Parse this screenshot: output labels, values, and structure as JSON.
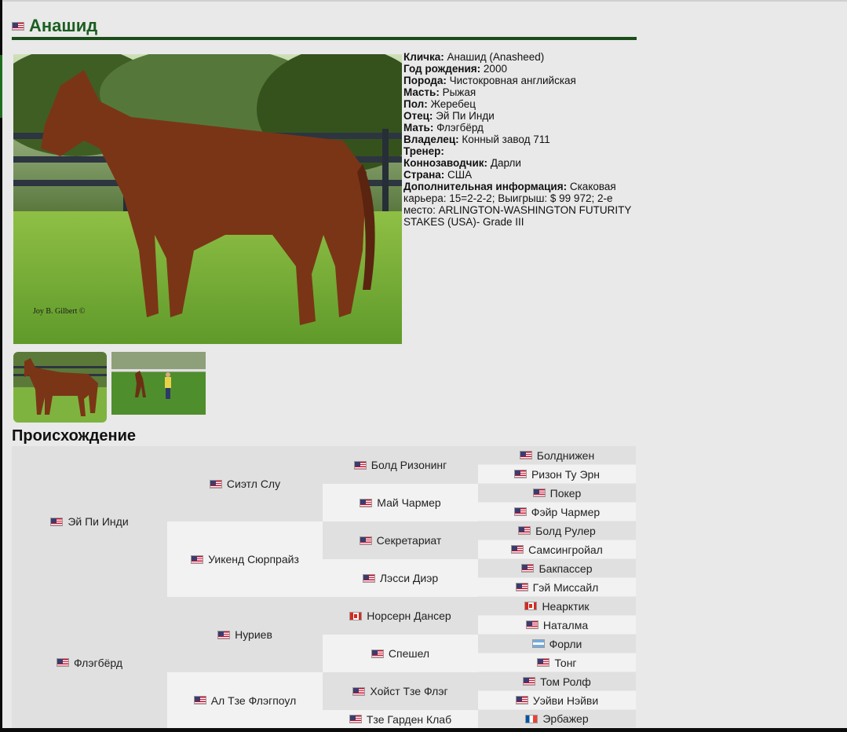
{
  "horse": {
    "title": "Анашид",
    "title_flag": "us-flag-icon"
  },
  "info": [
    {
      "label": "Кличка:",
      "value": " Анашид (Anasheed)"
    },
    {
      "label": "Год рождения:",
      "value": " 2000"
    },
    {
      "label": "Порода:",
      "value": " Чистокровная английская"
    },
    {
      "label": "Масть:",
      "value": " Рыжая"
    },
    {
      "label": "Пол:",
      "value": " Жеребец"
    },
    {
      "label": "Отец:",
      "value": " Эй Пи Инди"
    },
    {
      "label": "Мать:",
      "value": " Флэгбёрд"
    },
    {
      "label": "Владелец:",
      "value": " Конный завод 711"
    },
    {
      "label": "Тренер:",
      "value": ""
    },
    {
      "label": "Коннозаводчик:",
      "value": " Дарли"
    },
    {
      "label": "Страна:",
      "value": " США"
    },
    {
      "label": "Дополнительная информация:",
      "value": " Скаковая карьера: 15=2-2-2; Выигрыш: $ 99 972; 2-е место: ARLINGTON-WASHINGTON FUTURITY STAKES (USA)- Grade III"
    }
  ],
  "photo": {
    "watermark": "Joy B. Gilbert ©"
  },
  "pedigree": {
    "title": "Происхождение",
    "gen1": [
      {
        "name": "Эй Пи Инди",
        "flag": "us"
      },
      {
        "name": "Флэгбёрд",
        "flag": "us"
      }
    ],
    "gen2": [
      {
        "name": "Сиэтл Слу",
        "flag": "us"
      },
      {
        "name": "Уикенд Сюрпрайз",
        "flag": "us"
      },
      {
        "name": "Нуриев",
        "flag": "us"
      },
      {
        "name": "Ал Тзе Флэгпоул",
        "flag": "us"
      }
    ],
    "gen3": [
      {
        "name": "Болд Ризонинг",
        "flag": "us"
      },
      {
        "name": "Май Чармер",
        "flag": "us"
      },
      {
        "name": "Секретариат",
        "flag": "us"
      },
      {
        "name": "Лэсси Диэр",
        "flag": "us"
      },
      {
        "name": "Норсерн Дансер",
        "flag": "ca"
      },
      {
        "name": "Спешел",
        "flag": "us"
      },
      {
        "name": "Хойст Тзе Флэг",
        "flag": "us"
      },
      {
        "name": "Тзе Гарден Клаб",
        "flag": "us"
      }
    ],
    "gen4": [
      {
        "name": "Болднижен",
        "flag": "us"
      },
      {
        "name": "Ризон Ту Эрн",
        "flag": "us"
      },
      {
        "name": "Покер",
        "flag": "us"
      },
      {
        "name": "Фэйр Чармер",
        "flag": "us"
      },
      {
        "name": "Болд Рулер",
        "flag": "us"
      },
      {
        "name": "Самсингройал",
        "flag": "us"
      },
      {
        "name": "Бакпассер",
        "flag": "us"
      },
      {
        "name": "Гэй Миссайл",
        "flag": "us"
      },
      {
        "name": "Неарктик",
        "flag": "ca"
      },
      {
        "name": "Наталма",
        "flag": "us"
      },
      {
        "name": "Форли",
        "flag": "ar"
      },
      {
        "name": "Тонг",
        "flag": "us"
      },
      {
        "name": "Том Ролф",
        "flag": "us"
      },
      {
        "name": "Уэйви Нэйви",
        "flag": "us"
      },
      {
        "name": "Эрбажер",
        "flag": "fr"
      }
    ]
  }
}
